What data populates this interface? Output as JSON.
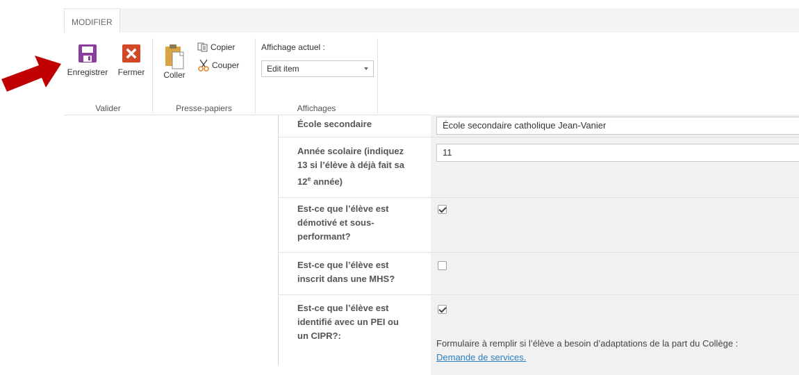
{
  "ribbon": {
    "tab": "MODIFIER",
    "groups": {
      "valider": {
        "label": "Valider",
        "save": "Enregistrer",
        "close": "Fermer"
      },
      "presse_papiers": {
        "label": "Presse-papiers",
        "paste": "Coller",
        "copy": "Copier",
        "cut": "Couper"
      },
      "affichages": {
        "label": "Affichages",
        "current_view_label": "Affichage actuel :",
        "current_view_value": "Edit item"
      }
    }
  },
  "form": {
    "ecole": {
      "label": "École secondaire",
      "value": "École secondaire catholique Jean-Vanier"
    },
    "annee": {
      "label_line1": "Année scolaire (indiquez",
      "label_line2": "13 si l’élève à déjà fait sa",
      "label_line3_pre": "12",
      "label_line3_sup": "e",
      "label_line3_post": " année)",
      "value": "11"
    },
    "demotive": {
      "label_line1": "Est-ce que l’élève est",
      "label_line2": "démotivé et sous-",
      "label_line3": "performant?",
      "checked": true
    },
    "mhs": {
      "label_line1": "Est-ce que l’élève est",
      "label_line2": "inscrit dans une MHS?",
      "checked": false
    },
    "pei": {
      "label_line1": "Est-ce que l’élève est",
      "label_line2": "identifié avec un PEI ou",
      "label_line3": "un CIPR?:",
      "checked": true,
      "note": "Formulaire à remplir si l’élève a besoin d’adaptations de la part du Collège :",
      "link": "Demande de services."
    }
  },
  "colors": {
    "save_icon": "#8a3d9c",
    "close_icon": "#d24726",
    "pointer_arrow": "#c00000",
    "link": "#2a7fc4"
  }
}
